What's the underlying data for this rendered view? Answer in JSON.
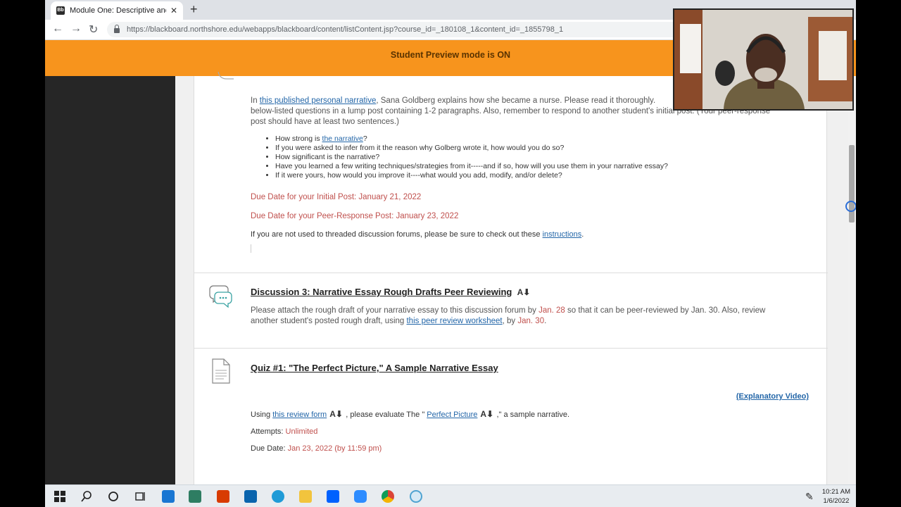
{
  "browser": {
    "tab_title": "Module One: Descriptive and Na",
    "tab_favicon_text": "Bb",
    "url": "https://blackboard.northshore.edu/webapps/blackboard/content/listContent.jsp?course_id=_180108_1&content_id=_1855798_1"
  },
  "banner": {
    "text": "Student Preview mode is ON"
  },
  "discussion2": {
    "para_pre": "In ",
    "para_link": "this published personal narrative",
    "para_post": ", Sana Goldberg explains how she became a nurse. Please read it thoroughly.",
    "para_line2": "below-listed questions in a lump post containing 1-2 paragraphs. Also, remember to respond to another student's initial post. (Your peer-response",
    "para_line3": "post should have at least two sentences.)",
    "q1_pre": "How strong is ",
    "q1_link": "the narrative",
    "q1_post": "?",
    "q2": "If you were asked to infer from it the reason why Golberg wrote it, how would you do so?",
    "q3": "How significant is the narrative?",
    "q4": "Have you learned a few writing techniques/strategies from it-----and if so, how will you use them in your narrative essay?",
    "q5": "If it were yours, how would you improve it----what would you add, modify, and/or delete?",
    "due_initial": "Due Date for your Initial Post: January 21, 2022",
    "due_peer": "Due Date for your Peer-Response Post: January 23, 2022",
    "threaded_pre": "If you are not used to threaded discussion forums, please be sure to check out these ",
    "threaded_link": "instructions",
    "threaded_post": "."
  },
  "discussion3": {
    "title": "Discussion 3: Narrative Essay Rough Drafts Peer Reviewing",
    "text_a": "Please attach the rough draft of your narrative essay to this discussion forum by ",
    "date_a": "Jan. 28",
    "text_b": " so that it can be peer-reviewed by Jan.  30. Also, review",
    "text_c": "another student's posted rough draft, using ",
    "link": "this peer review worksheet",
    "text_d": ", by ",
    "date_b": "Jan. 30",
    "text_e": "."
  },
  "quiz1": {
    "title": "Quiz #1: \"The Perfect Picture,\" A Sample Narrative Essay",
    "explanatory_link": "(Explanatory Video)",
    "using": "Using ",
    "review_link": "this review form",
    "evaluate": " , please evaluate The \" ",
    "perfect_link": "Perfect Picture",
    "sample": " ,\" a sample narrative.",
    "attempts_label": "Attempts: ",
    "attempts_value": "Unlimited",
    "due_label": "Due Date: ",
    "due_value": "Jan 23, 2022 (by 11:59 pm)"
  },
  "taskbar": {
    "time": "10:21 AM",
    "date": "1/6/2022"
  },
  "colors": {
    "banner": "#f7941d",
    "link": "#2366a8",
    "due": "#c0504d",
    "sidebar": "#262626"
  }
}
